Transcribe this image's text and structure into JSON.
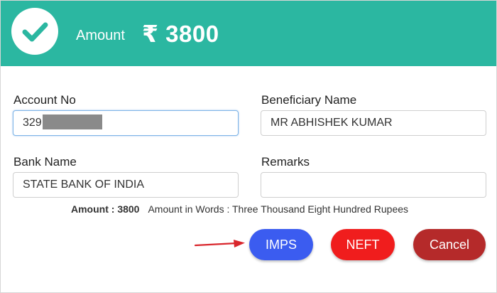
{
  "header": {
    "amount_label": "Amount",
    "amount_value": "₹ 3800",
    "background_color": "#2bb7a1",
    "icon": "check-circle-icon"
  },
  "form": {
    "account_no": {
      "label": "Account No",
      "value": "329"
    },
    "beneficiary_name": {
      "label": "Beneficiary Name",
      "value": "MR ABHISHEK KUMAR"
    },
    "bank_name": {
      "label": "Bank Name",
      "value": "STATE BANK OF INDIA"
    },
    "remarks": {
      "label": "Remarks",
      "value": ""
    }
  },
  "summary": {
    "amount_label": "Amount : 3800",
    "amount_words": "Amount in Words : Three Thousand Eight Hundred Rupees"
  },
  "buttons": {
    "imps": {
      "label": "IMPS",
      "color": "#3b5cf0"
    },
    "neft": {
      "label": "NEFT",
      "color": "#f01d1d"
    },
    "cancel": {
      "label": "Cancel",
      "color": "#b52a2a"
    }
  },
  "annotation": {
    "arrow_color": "#d9262c",
    "icon": "arrow-right-icon"
  }
}
